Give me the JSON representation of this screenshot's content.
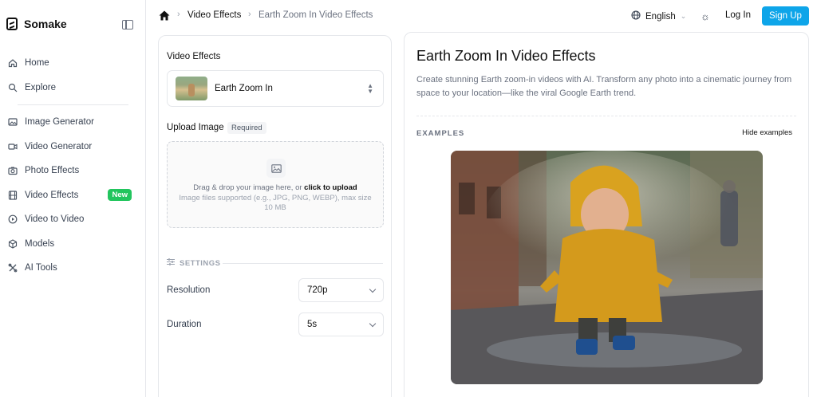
{
  "brand": {
    "name": "Somake"
  },
  "sidebar": {
    "items": [
      {
        "label": "Home",
        "icon": "home-icon"
      },
      {
        "label": "Explore",
        "icon": "search-icon"
      },
      {
        "label": "Image Generator",
        "icon": "image-icon"
      },
      {
        "label": "Video Generator",
        "icon": "video-camera-icon"
      },
      {
        "label": "Photo Effects",
        "icon": "camera-icon"
      },
      {
        "label": "Video Effects",
        "icon": "film-icon",
        "badge": "New"
      },
      {
        "label": "Video to Video",
        "icon": "play-circle-icon"
      },
      {
        "label": "Models",
        "icon": "cube-icon"
      },
      {
        "label": "AI Tools",
        "icon": "tools-icon"
      }
    ]
  },
  "header": {
    "breadcrumb": [
      "Video Effects",
      "Earth Zoom In Video Effects"
    ],
    "language": "English",
    "login": "Log In",
    "signup": "Sign Up"
  },
  "form": {
    "effects_label": "Video Effects",
    "effect_selected": "Earth Zoom In",
    "upload_label": "Upload Image",
    "required": "Required",
    "drop_text": "Drag & drop your image here, or ",
    "drop_link": "click to upload",
    "drop_hint": "Image files supported (e.g., JPG, PNG, WEBP), max size 10 MB",
    "settings_heading": "SETTINGS",
    "resolution_label": "Resolution",
    "resolution_value": "720p",
    "duration_label": "Duration",
    "duration_value": "5s"
  },
  "content": {
    "title": "Earth Zoom In Video Effects",
    "description": "Create stunning Earth zoom-in videos with AI. Transform any photo into a cinematic journey from space to your location—like the viral Google Earth trend.",
    "examples_heading": "EXAMPLES",
    "hide_examples": "Hide examples"
  },
  "colors": {
    "accent": "#0ea5e9",
    "new_badge": "#22c55e"
  }
}
